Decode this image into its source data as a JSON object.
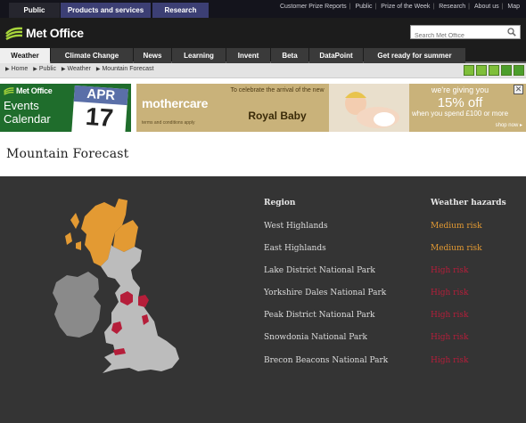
{
  "top_tabs": [
    "Public",
    "Products and services",
    "Research"
  ],
  "top_links": [
    "Customer Prize Reports",
    "Public",
    "Prize of the Week",
    "Research",
    "About us",
    "Map"
  ],
  "header": {
    "brand": "Met Office",
    "search_placeholder": "Search Met Office"
  },
  "nav": [
    "Weather",
    "Climate Change",
    "News",
    "Learning",
    "Invent",
    "Beta",
    "DataPoint",
    "Get ready for summer"
  ],
  "breadcrumb": [
    "Home",
    "Public",
    "Weather",
    "Mountain Forecast"
  ],
  "social_icons": [
    "share-icon",
    "print-icon",
    "rss-icon",
    "person-icon",
    "menu-icon"
  ],
  "banner_events": {
    "brand": "Met Office",
    "line1": "Events",
    "line2": "Calendar",
    "month": "APR",
    "day": "17"
  },
  "banner_ad": {
    "brand": "mothercare",
    "terms": "terms and conditions apply",
    "royal_line1": "To celebrate the arrival of the new",
    "royal_line2": "Royal Baby",
    "offer_line1": "we're giving you",
    "offer_line2": "15% off",
    "offer_line3": "when you spend £100 or more",
    "shop_now": "shop now ▸"
  },
  "page_title": "Mountain Forecast",
  "forecast": {
    "header_region": "Region",
    "header_hazards": "Weather hazards",
    "rows": [
      {
        "region": "West Highlands",
        "risk": "Medium risk",
        "level": "medium"
      },
      {
        "region": "East Highlands",
        "risk": "Medium risk",
        "level": "medium"
      },
      {
        "region": "Lake District National Park",
        "risk": "High risk",
        "level": "high"
      },
      {
        "region": "Yorkshire Dales National Park",
        "risk": "High risk",
        "level": "high"
      },
      {
        "region": "Peak District National Park",
        "risk": "High risk",
        "level": "high"
      },
      {
        "region": "Snowdonia National Park",
        "risk": "High risk",
        "level": "high"
      },
      {
        "region": "Brecon Beacons National Park",
        "risk": "High risk",
        "level": "high"
      }
    ]
  },
  "colors": {
    "medium_risk": "#e39a33",
    "high_risk": "#b51e3a",
    "map_land": "#bcbcbc",
    "ireland": "#8a8a8a",
    "panel_bg": "#343434",
    "nav_active": "#efefef",
    "header_bg": "#1c1c1c",
    "logo_green": "#a7d53b"
  }
}
